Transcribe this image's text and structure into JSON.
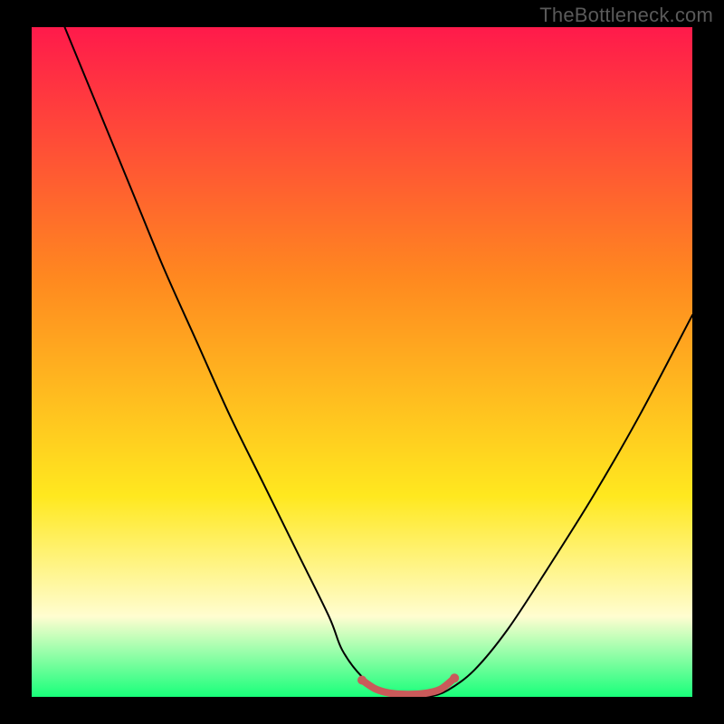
{
  "watermark": {
    "text": "TheBottleneck.com"
  },
  "chart_data": {
    "type": "line",
    "title": "",
    "xlabel": "",
    "ylabel": "",
    "xlim": [
      0,
      100
    ],
    "ylim": [
      0,
      100
    ],
    "grid": false,
    "legend": false,
    "background_gradient": {
      "top_color": "#ff1a4b",
      "mid1_color": "#ff8a1f",
      "mid2_color": "#ffe81f",
      "band_color": "#fffdd0",
      "bottom_color": "#18ff7a"
    },
    "series": [
      {
        "name": "bottleneck-curve",
        "color": "#000000",
        "x": [
          5,
          10,
          15,
          20,
          25,
          30,
          35,
          40,
          45,
          47,
          50,
          53,
          57,
          60,
          63,
          67,
          72,
          78,
          85,
          92,
          100
        ],
        "y": [
          100,
          88,
          76,
          64,
          53,
          42,
          32,
          22,
          12,
          7,
          3,
          1,
          0,
          0,
          1,
          4,
          10,
          19,
          30,
          42,
          57
        ]
      },
      {
        "name": "optimal-range-marker",
        "color": "#c95a5a",
        "x": [
          50,
          52,
          54,
          56,
          58,
          60,
          62,
          64
        ],
        "y": [
          2.5,
          1.2,
          0.6,
          0.4,
          0.4,
          0.6,
          1.2,
          2.8
        ]
      }
    ]
  }
}
